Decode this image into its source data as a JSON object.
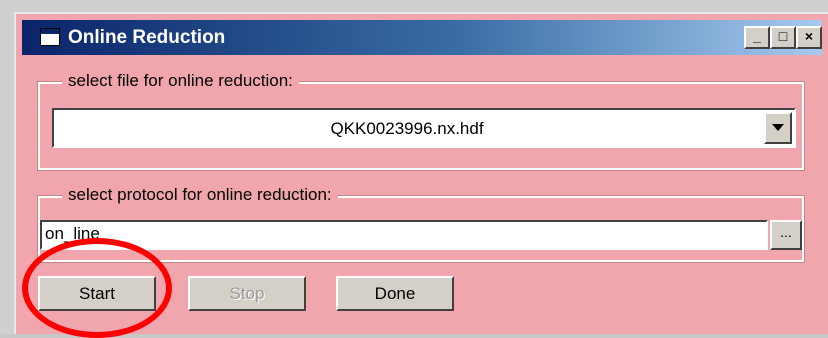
{
  "window": {
    "title": "Online Reduction",
    "controls": {
      "minimize": "_",
      "maximize": "□",
      "close": "×"
    }
  },
  "file_group": {
    "label": "select file for online reduction:",
    "selected_file": "QKK0023996.nx.hdf"
  },
  "protocol_group": {
    "label": "select protocol for online reduction:",
    "value": "on_line",
    "browse_label": "..."
  },
  "buttons": {
    "start": "Start",
    "stop": "Stop",
    "done": "Done"
  },
  "colors": {
    "window_bg": "#f0a6ac",
    "titlebar_start": "#0a246a",
    "annotation": "#ff0000"
  }
}
